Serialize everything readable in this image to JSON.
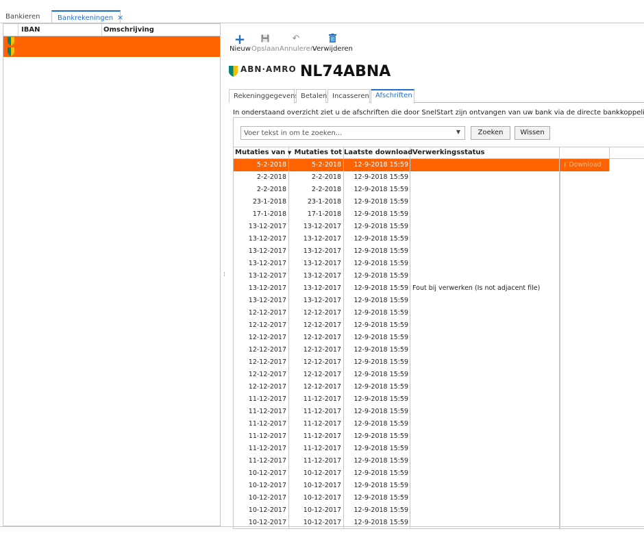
{
  "top_tabs": [
    {
      "label": "Bankieren"
    },
    {
      "label": "Bankrekeningen",
      "close": "×"
    }
  ],
  "left_grid": {
    "headers": {
      "iban": "IBAN",
      "omschrijving": "Omschrijving"
    },
    "rows": [
      {
        "iban": "",
        "omschrijving": ""
      },
      {
        "iban": "",
        "omschrijving": ""
      }
    ]
  },
  "toolbar": {
    "nieuw": "Nieuw",
    "opslaan": "Opslaan",
    "annuleren": "Annuleren",
    "verwijderen": "Verwijderen"
  },
  "bank": {
    "logo_text": "ABN·AMRO",
    "iban_title": "NL74ABNA",
    "brand_colors": {
      "teal": "#00857a",
      "yellow": "#f5c000"
    }
  },
  "sub_tabs": [
    {
      "label": "Rekeninggegevens"
    },
    {
      "label": "Betalen"
    },
    {
      "label": "Incasseren"
    },
    {
      "label": "Afschriften",
      "active": true
    }
  ],
  "info_text": "In onderstaand overzicht ziet u de afschriften die door SnelStart zijn ontvangen van uw bank via de directe bankkoppeling.",
  "search": {
    "placeholder": "Voer tekst in om te zoeken...",
    "zoeken": "Zoeken",
    "wissen": "Wissen"
  },
  "grid": {
    "headers": {
      "van": "Mutaties van",
      "tot": "Mutaties tot",
      "download": "Laatste download",
      "status": "Verwerkingsstatus"
    },
    "download_button": "Download",
    "selected_color": "#ff6200",
    "rows": [
      {
        "van": "5-2-2018",
        "tot": "5-2-2018",
        "dl": "12-9-2018 15:59",
        "status": ""
      },
      {
        "van": "2-2-2018",
        "tot": "2-2-2018",
        "dl": "12-9-2018 15:59",
        "status": ""
      },
      {
        "van": "2-2-2018",
        "tot": "2-2-2018",
        "dl": "12-9-2018 15:59",
        "status": ""
      },
      {
        "van": "23-1-2018",
        "tot": "23-1-2018",
        "dl": "12-9-2018 15:59",
        "status": ""
      },
      {
        "van": "17-1-2018",
        "tot": "17-1-2018",
        "dl": "12-9-2018 15:59",
        "status": ""
      },
      {
        "van": "13-12-2017",
        "tot": "13-12-2017",
        "dl": "12-9-2018 15:59",
        "status": ""
      },
      {
        "van": "13-12-2017",
        "tot": "13-12-2017",
        "dl": "12-9-2018 15:59",
        "status": ""
      },
      {
        "van": "13-12-2017",
        "tot": "13-12-2017",
        "dl": "12-9-2018 15:59",
        "status": ""
      },
      {
        "van": "13-12-2017",
        "tot": "13-12-2017",
        "dl": "12-9-2018 15:59",
        "status": ""
      },
      {
        "van": "13-12-2017",
        "tot": "13-12-2017",
        "dl": "12-9-2018 15:59",
        "status": ""
      },
      {
        "van": "13-12-2017",
        "tot": "13-12-2017",
        "dl": "12-9-2018 15:59",
        "status": "Fout bij verwerken (Is not adjacent file)"
      },
      {
        "van": "13-12-2017",
        "tot": "13-12-2017",
        "dl": "12-9-2018 15:59",
        "status": ""
      },
      {
        "van": "12-12-2017",
        "tot": "12-12-2017",
        "dl": "12-9-2018 15:59",
        "status": ""
      },
      {
        "van": "12-12-2017",
        "tot": "12-12-2017",
        "dl": "12-9-2018 15:59",
        "status": ""
      },
      {
        "van": "12-12-2017",
        "tot": "12-12-2017",
        "dl": "12-9-2018 15:59",
        "status": ""
      },
      {
        "van": "12-12-2017",
        "tot": "12-12-2017",
        "dl": "12-9-2018 15:59",
        "status": ""
      },
      {
        "van": "12-12-2017",
        "tot": "12-12-2017",
        "dl": "12-9-2018 15:59",
        "status": ""
      },
      {
        "van": "12-12-2017",
        "tot": "12-12-2017",
        "dl": "12-9-2018 15:59",
        "status": ""
      },
      {
        "van": "12-12-2017",
        "tot": "12-12-2017",
        "dl": "12-9-2018 15:59",
        "status": ""
      },
      {
        "van": "11-12-2017",
        "tot": "11-12-2017",
        "dl": "12-9-2018 15:59",
        "status": ""
      },
      {
        "van": "11-12-2017",
        "tot": "11-12-2017",
        "dl": "12-9-2018 15:59",
        "status": ""
      },
      {
        "van": "11-12-2017",
        "tot": "11-12-2017",
        "dl": "12-9-2018 15:59",
        "status": ""
      },
      {
        "van": "11-12-2017",
        "tot": "11-12-2017",
        "dl": "12-9-2018 15:59",
        "status": ""
      },
      {
        "van": "11-12-2017",
        "tot": "11-12-2017",
        "dl": "12-9-2018 15:59",
        "status": ""
      },
      {
        "van": "11-12-2017",
        "tot": "11-12-2017",
        "dl": "12-9-2018 15:59",
        "status": ""
      },
      {
        "van": "10-12-2017",
        "tot": "10-12-2017",
        "dl": "12-9-2018 15:59",
        "status": ""
      },
      {
        "van": "10-12-2017",
        "tot": "10-12-2017",
        "dl": "12-9-2018 15:59",
        "status": ""
      },
      {
        "van": "10-12-2017",
        "tot": "10-12-2017",
        "dl": "12-9-2018 15:59",
        "status": ""
      },
      {
        "van": "10-12-2017",
        "tot": "10-12-2017",
        "dl": "12-9-2018 15:59",
        "status": ""
      },
      {
        "van": "10-12-2017",
        "tot": "10-12-2017",
        "dl": "12-9-2018 15:59",
        "status": ""
      }
    ]
  }
}
